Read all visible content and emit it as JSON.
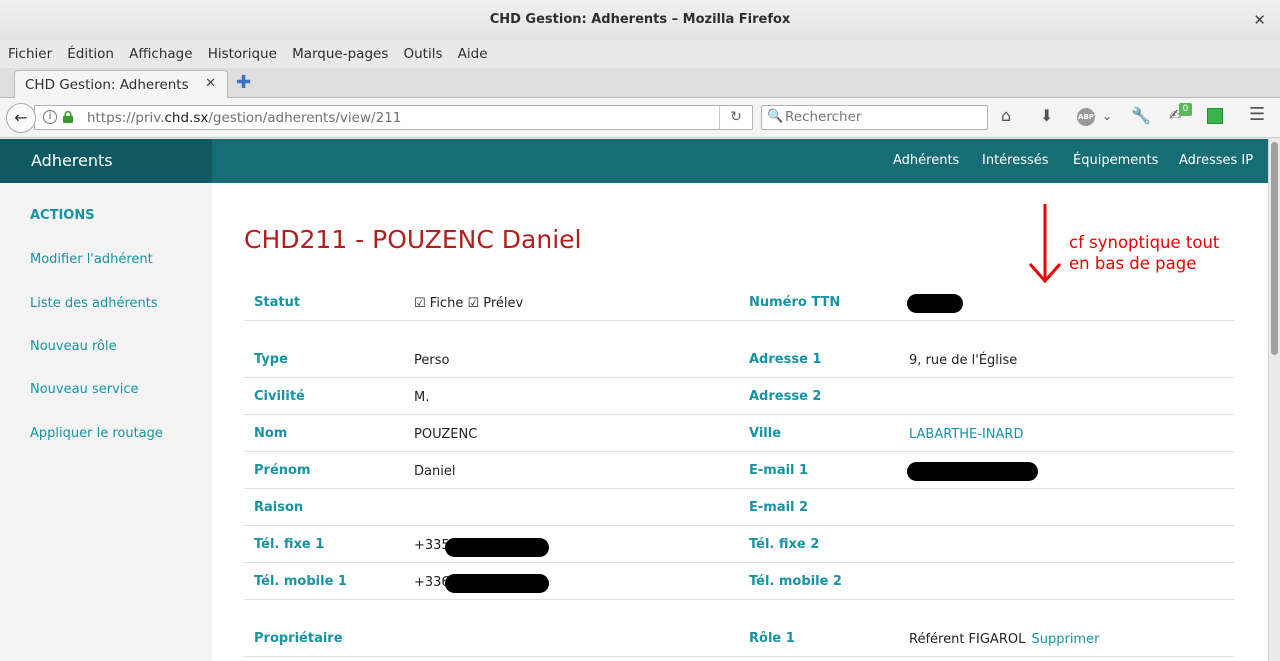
{
  "window": {
    "title": "CHD Gestion: Adherents – Mozilla Firefox"
  },
  "menu": [
    "Fichier",
    "Édition",
    "Affichage",
    "Historique",
    "Marque-pages",
    "Outils",
    "Aide"
  ],
  "tab": {
    "label": "CHD Gestion: Adherents"
  },
  "url": {
    "prefix": "https://priv.",
    "domain": "chd.sx",
    "path": "/gestion/adherents/view/211"
  },
  "search": {
    "placeholder": "Rechercher"
  },
  "toolbar": {
    "badge": "0"
  },
  "app": {
    "brand": "Adherents",
    "nav": [
      "Adhérents",
      "Intéressés",
      "Équipements",
      "Adresses IP"
    ]
  },
  "sidebar": {
    "heading": "ACTIONS",
    "items": [
      "Modifier l'adhérent",
      "Liste des adhérents",
      "Nouveau rôle",
      "Nouveau service",
      "Appliquer le routage"
    ]
  },
  "record": {
    "title": "CHD211 - POUZENC Daniel"
  },
  "annotation": {
    "line1": "cf synoptique tout",
    "line2": "en bas de page"
  },
  "fields": {
    "statut": {
      "label": "Statut",
      "value": "☑ Fiche ☑ Prélev"
    },
    "ttn": {
      "label": "Numéro TTN"
    },
    "type": {
      "label": "Type",
      "value": "Perso"
    },
    "adresse1": {
      "label": "Adresse 1",
      "value": "9, rue de l'Église"
    },
    "civilite": {
      "label": "Civilité",
      "value": "M."
    },
    "adresse2": {
      "label": "Adresse 2"
    },
    "nom": {
      "label": "Nom",
      "value": "POUZENC"
    },
    "ville": {
      "label": "Ville",
      "value": "LABARTHE-INARD"
    },
    "prenom": {
      "label": "Prénom",
      "value": "Daniel"
    },
    "email1": {
      "label": "E-mail 1"
    },
    "raison": {
      "label": "Raison"
    },
    "email2": {
      "label": "E-mail 2"
    },
    "telfixe1": {
      "label": "Tél. fixe 1",
      "value": "+335"
    },
    "telfixe2": {
      "label": "Tél. fixe 2"
    },
    "telmobile1": {
      "label": "Tél. mobile 1",
      "value": "+336"
    },
    "telmobile2": {
      "label": "Tél. mobile 2"
    },
    "proprietaire": {
      "label": "Propriétaire"
    },
    "role1": {
      "label": "Rôle 1",
      "value": "Référent FIGAROL",
      "action": "Supprimer"
    }
  },
  "colors": {
    "teal": "#176d74",
    "teal_dark": "#0f5a60",
    "accent": "#1793a4",
    "title_red": "#b21f1f",
    "note_red": "#ee0000"
  }
}
